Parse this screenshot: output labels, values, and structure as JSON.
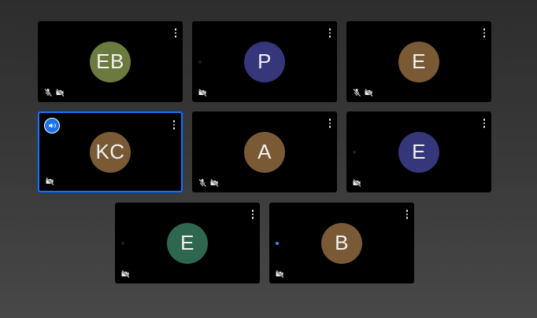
{
  "colors": {
    "accent": "#1a73e8",
    "tile_background": "#000000",
    "speaking_dot": "#4285f4",
    "idle_dot": "#1e1e1e"
  },
  "participants": [
    {
      "initials": "EB",
      "avatar_color": "#6b7a3e",
      "mic_muted": true,
      "camera_off": true,
      "active": false,
      "presenter_badge": false,
      "dot": ""
    },
    {
      "initials": "P",
      "avatar_color": "#36367a",
      "mic_muted": false,
      "camera_off": true,
      "active": false,
      "presenter_badge": false,
      "dot": "idle"
    },
    {
      "initials": "E",
      "avatar_color": "#7a5a35",
      "mic_muted": true,
      "camera_off": true,
      "active": false,
      "presenter_badge": false,
      "dot": ""
    },
    {
      "initials": "KC",
      "avatar_color": "#7a5a35",
      "mic_muted": false,
      "camera_off": true,
      "active": true,
      "presenter_badge": true,
      "dot": ""
    },
    {
      "initials": "A",
      "avatar_color": "#7a5a35",
      "mic_muted": true,
      "camera_off": true,
      "active": false,
      "presenter_badge": false,
      "dot": ""
    },
    {
      "initials": "E",
      "avatar_color": "#36367a",
      "mic_muted": false,
      "camera_off": true,
      "active": false,
      "presenter_badge": false,
      "dot": "idle"
    },
    {
      "initials": "E",
      "avatar_color": "#2e6650",
      "mic_muted": false,
      "camera_off": true,
      "active": false,
      "presenter_badge": false,
      "dot": "idle"
    },
    {
      "initials": "B",
      "avatar_color": "#7a5a35",
      "mic_muted": false,
      "camera_off": true,
      "active": false,
      "presenter_badge": false,
      "dot": "speaking"
    }
  ],
  "icons": {
    "more": "more-vert-icon",
    "mic_off": "mic-off-icon",
    "camera_off": "videocam-off-icon",
    "presenter": "megaphone-icon"
  }
}
